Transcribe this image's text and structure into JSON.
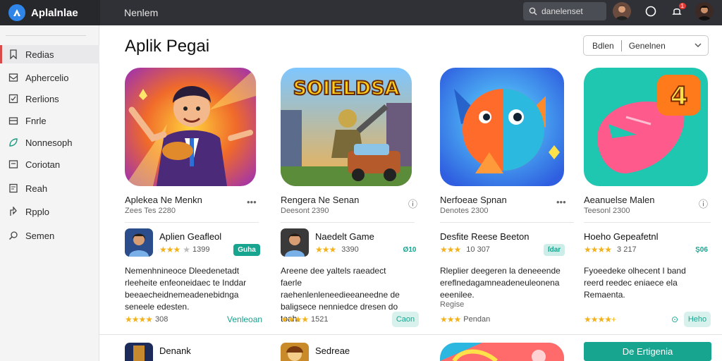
{
  "app": {
    "name": "Aplalnlae",
    "nav_label": "Nenlem"
  },
  "search": {
    "text": "danelenset"
  },
  "notifications": {
    "count": "1"
  },
  "sidebar": {
    "items": [
      {
        "label": "Redias",
        "icon": "bookmark-icon",
        "active": true
      },
      {
        "label": "Aphercelio",
        "icon": "inbox-icon"
      },
      {
        "label": "Rerlions",
        "icon": "checkbox-icon"
      },
      {
        "label": "Fnrle",
        "icon": "tray-icon"
      },
      {
        "label": "Nonnesoph",
        "icon": "leaf-icon"
      },
      {
        "label": "Coriotan",
        "icon": "card-icon"
      },
      {
        "label": "Reah",
        "icon": "document-icon"
      },
      {
        "label": "Rpplo",
        "icon": "share-icon"
      },
      {
        "label": "Semen",
        "icon": "search-icon"
      }
    ]
  },
  "page": {
    "title": "Aplik Pegai"
  },
  "filter": {
    "left": "Bdlen",
    "right": "Genelnen"
  },
  "featured": [
    {
      "title": "Aplekea Ne Menkn",
      "subtitle": "Zees Tes 2280"
    },
    {
      "title": "Rengera Ne Senan",
      "subtitle": "Deesont 2390",
      "tile_text": "SOIELDSA"
    },
    {
      "title": "Nerfoeae Spnan",
      "subtitle": "Denotes 2300"
    },
    {
      "title": "Aeanuelse Malen",
      "subtitle": "Teesonl 2300",
      "tile_text": "4"
    }
  ],
  "apps": [
    {
      "name": "Aplien Geafleol",
      "rating": "★★★",
      "rating_suffix": "★",
      "count": "1399",
      "pill": "Guha",
      "desc": "Nemenhnineoce Dleedenetadt rleeheite enfeoneidaec te Inddar beeaecheidnemeadenebidnga seneele edesten.",
      "meta_stars": "★★★★",
      "meta_count": "308",
      "action": "Venleoan"
    },
    {
      "name": "Naedelt Game",
      "rating": "★★★",
      "rating_suffix": "",
      "count": "3390",
      "pill": "Ø10",
      "desc": "Areene dee yaltels raeadect faerle raehenlenleneedieeaneedne de baligsece nenniedce dresen do toah.",
      "meta_stars": "★★★★",
      "meta_count": "1521",
      "action": "Caon"
    },
    {
      "name": "Desfite Reese Beeton",
      "rating": "★★★",
      "rating_suffix": "",
      "count": "10 307",
      "pill": "ſdar",
      "desc": "Rleplier deegeren la deneeende ereflnedagamneadeneuleonena eeenilee.",
      "extra": "Regise",
      "meta_stars": "★★★",
      "meta_count": "Pendan",
      "action": ""
    },
    {
      "name": "Hoeho Gepeafetnl",
      "rating": "★★★★",
      "rating_suffix": "",
      "count": "3 217",
      "pill": "Ş06",
      "desc": "Fyoeedeke olhecent I band reerd reedec eniaece ela Remaenta.",
      "meta_stars": "★★★★+",
      "meta_count": "",
      "action": "Heho"
    }
  ],
  "row2": [
    {
      "name": "Denank"
    },
    {
      "name": "Sedreae"
    }
  ],
  "cta": {
    "label": "De Ertigenia"
  }
}
